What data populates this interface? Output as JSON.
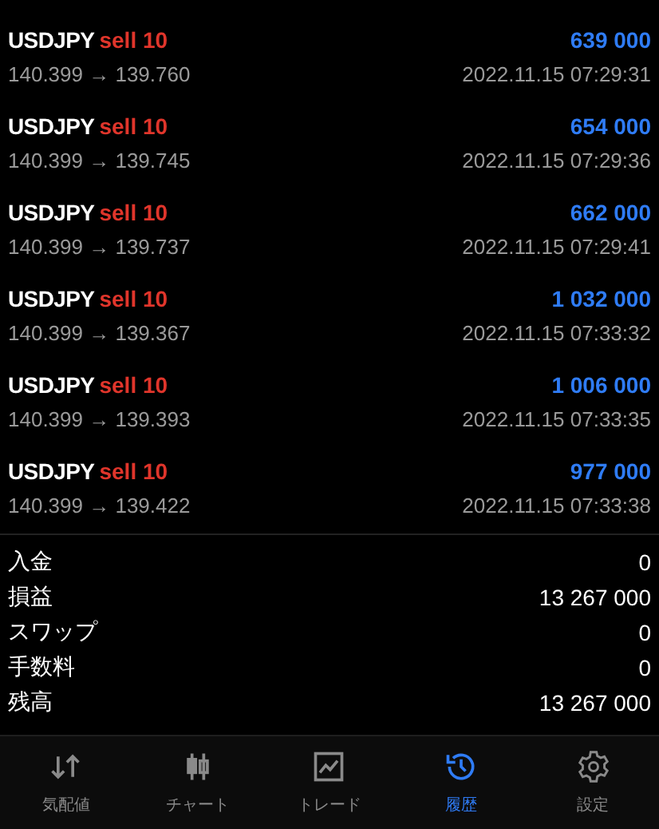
{
  "deals": [
    {
      "symbol": "USDJPY",
      "side": "sell",
      "volume": "10",
      "profit": "639 000",
      "prices": "140.399 → 139.760",
      "time": "2022.11.15 07:29:31"
    },
    {
      "symbol": "USDJPY",
      "side": "sell",
      "volume": "10",
      "profit": "654 000",
      "prices": "140.399 → 139.745",
      "time": "2022.11.15 07:29:36"
    },
    {
      "symbol": "USDJPY",
      "side": "sell",
      "volume": "10",
      "profit": "662 000",
      "prices": "140.399 → 139.737",
      "time": "2022.11.15 07:29:41"
    },
    {
      "symbol": "USDJPY",
      "side": "sell",
      "volume": "10",
      "profit": "1 032 000",
      "prices": "140.399 → 139.367",
      "time": "2022.11.15 07:33:32"
    },
    {
      "symbol": "USDJPY",
      "side": "sell",
      "volume": "10",
      "profit": "1 006 000",
      "prices": "140.399 → 139.393",
      "time": "2022.11.15 07:33:35"
    },
    {
      "symbol": "USDJPY",
      "side": "sell",
      "volume": "10",
      "profit": "977 000",
      "prices": "140.399 → 139.422",
      "time": "2022.11.15 07:33:38"
    }
  ],
  "summary": [
    {
      "label": "入金",
      "value": "0"
    },
    {
      "label": "損益",
      "value": "13 267 000"
    },
    {
      "label": "スワップ",
      "value": "0"
    },
    {
      "label": "手数料",
      "value": "0"
    },
    {
      "label": "残高",
      "value": "13 267 000"
    }
  ],
  "tabs": [
    {
      "kind": "quotes",
      "label": "気配値",
      "selected": false
    },
    {
      "kind": "chart",
      "label": "チャート",
      "selected": false
    },
    {
      "kind": "trade",
      "label": "トレード",
      "selected": false
    },
    {
      "kind": "history",
      "label": "履歴",
      "selected": true
    },
    {
      "kind": "settings",
      "label": "設定",
      "selected": false
    }
  ]
}
